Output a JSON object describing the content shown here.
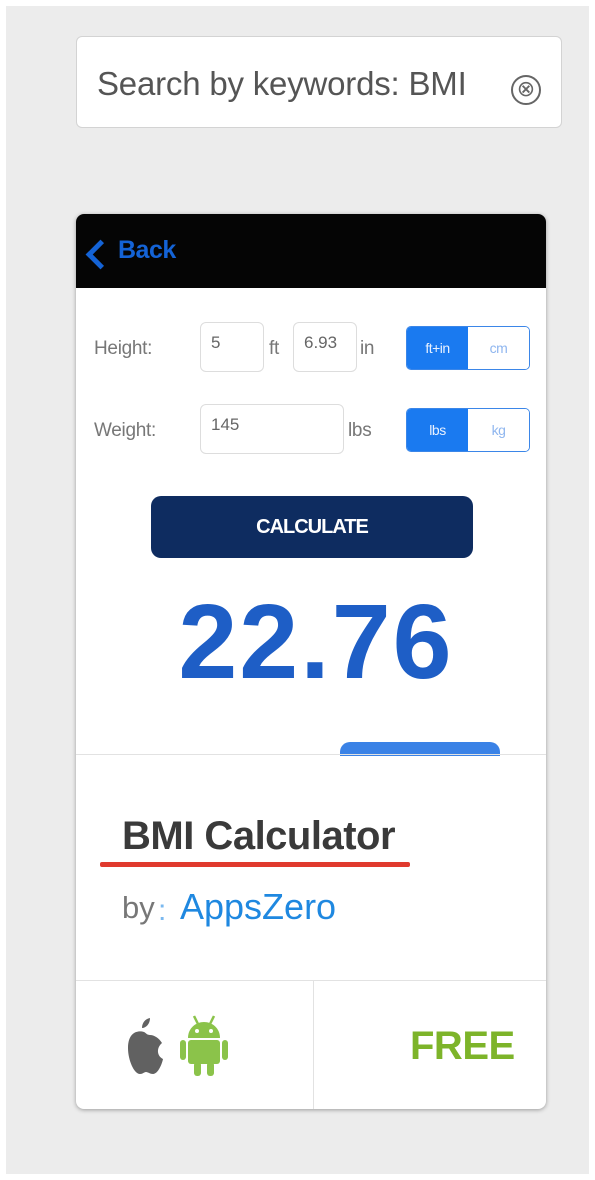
{
  "search": {
    "query": "Search by keywords: BMI",
    "clear_glyph": "⊗"
  },
  "card": {
    "screenshot": {
      "back_label": "Back",
      "height_label": "Height:",
      "height_ft": "5",
      "ft_unit": "ft",
      "height_in": "6.93",
      "in_unit": "in",
      "height_units": [
        "ft+in",
        "cm"
      ],
      "weight_label": "Weight:",
      "weight_value": "145",
      "weight_unit": "lbs",
      "weight_units": [
        "lbs",
        "kg"
      ],
      "calculate_label": "CALCULATE",
      "result": "22.76"
    },
    "app_name": "BMI Calculator",
    "by_label": "by",
    "by_separator": ":",
    "developer": "AppsZero",
    "platforms": [
      "apple-icon",
      "android-icon"
    ],
    "price": "FREE"
  },
  "colors": {
    "accent_blue": "#1a7af0",
    "result_blue": "#1e5ec6",
    "calculate_navy": "#0e2c60",
    "underline_red": "#e03a2e",
    "price_green": "#7db42a",
    "android_green": "#8bc34a"
  }
}
